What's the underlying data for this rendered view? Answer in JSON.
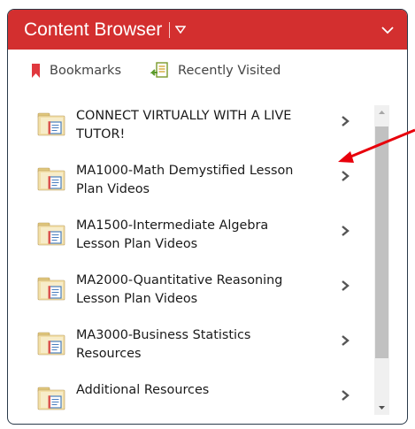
{
  "header": {
    "title": "Content Browser",
    "bg_color": "#d32f2f",
    "menu_icon": "caret-down-icon",
    "collapse_icon": "chevron-down-icon"
  },
  "toolbar": {
    "bookmarks_label": "Bookmarks",
    "bookmarks_icon": "bookmark-icon",
    "recent_label": "Recently Visited",
    "recent_icon": "recent-document-icon"
  },
  "items": [
    {
      "label": "CONNECT VIRTUALLY WITH A LIVE TUTOR!",
      "icon": "module-folder-icon"
    },
    {
      "label": "MA1000-Math Demystified Lesson Plan Videos",
      "icon": "module-folder-icon"
    },
    {
      "label": "MA1500-Intermediate Algebra Lesson Plan Videos",
      "icon": "module-folder-icon"
    },
    {
      "label": "MA2000-Quantitative Reasoning Lesson Plan Videos",
      "icon": "module-folder-icon"
    },
    {
      "label": "MA3000-Business Statistics Resources",
      "icon": "module-folder-icon"
    },
    {
      "label": "Additional Resources",
      "icon": "module-folder-icon"
    }
  ],
  "annotation": {
    "color": "#e8000b",
    "icon": "red-arrow-icon"
  }
}
